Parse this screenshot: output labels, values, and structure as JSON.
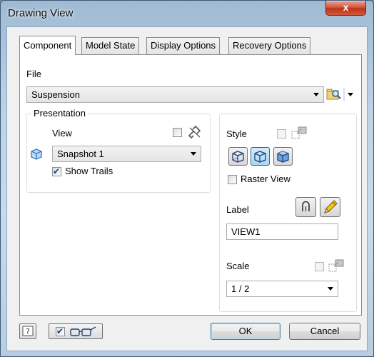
{
  "window": {
    "title": "Drawing View",
    "close_glyph": "x"
  },
  "tabs": [
    {
      "label": "Component",
      "active": true
    },
    {
      "label": "Model State",
      "active": false
    },
    {
      "label": "Display Options",
      "active": false
    },
    {
      "label": "Recovery Options",
      "active": false
    }
  ],
  "file": {
    "label": "File",
    "value": "Suspension"
  },
  "presentation": {
    "group_label": "Presentation",
    "view_label": "View",
    "view_value": "Snapshot 1",
    "show_trails_label": "Show Trails",
    "show_trails_checked": true,
    "view_checkbox_checked": false
  },
  "style": {
    "label": "Style",
    "buttons": [
      {
        "name": "hidden-line",
        "pressed": false
      },
      {
        "name": "hidden-line-removed",
        "pressed": true
      },
      {
        "name": "shaded",
        "pressed": false
      }
    ],
    "raster_view_label": "Raster View",
    "raster_view_checked": false
  },
  "label_section": {
    "label": "Label",
    "value": "VIEW1"
  },
  "scale": {
    "label": "Scale",
    "value": "1 / 2"
  },
  "footer": {
    "ok_label": "OK",
    "cancel_label": "Cancel",
    "preview_checked": true
  },
  "colors": {
    "accent_blue": "#2a6ebd",
    "pencil_yellow": "#f5c518"
  }
}
